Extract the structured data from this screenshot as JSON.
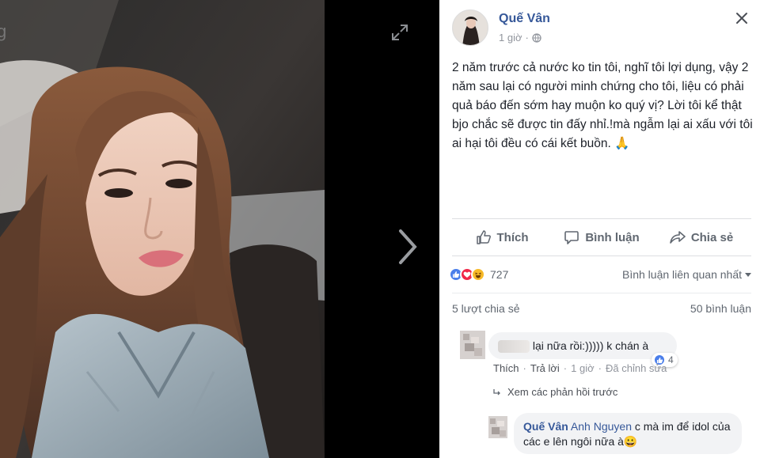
{
  "post": {
    "author": "Quế Vân",
    "time": "1 giờ",
    "text": "2 năm trước cả nước ko tin tôi, nghĩ tôi lợi dụng, vậy 2 năm sau lại có người minh chứng cho tôi, liệu có phải quả báo đến sớm hay muộn ko quý vị? Lời tôi kể thật bjo chắc sẽ được tin đấy nhỉ.!mà ngẫm lại ai xấu với tôi ai hại tôi đều có cái kết buồn. 🙏"
  },
  "actions": {
    "like": "Thích",
    "comment": "Bình luận",
    "share": "Chia sẻ"
  },
  "reactions": {
    "count": "727",
    "types": [
      "like-icon",
      "love-icon",
      "haha-icon"
    ],
    "colors": {
      "like": "#4a7eea",
      "love": "#f0284a",
      "haha": "#f7b928"
    }
  },
  "sort": {
    "label": "Bình luận liên quan nhất"
  },
  "stats": {
    "shares": "5 lượt chia sẻ",
    "comments": "50 bình luận"
  },
  "comments": [
    {
      "text": "lại nữa rồi:))))) k chán à",
      "likes": "4",
      "actions": {
        "like": "Thích",
        "reply": "Trả lời",
        "time": "1 giờ",
        "edited": "Đã chỉnh sửa"
      },
      "view_more": "Xem các phản hồi trước"
    },
    {
      "author": "Quế Vân",
      "tag": "Anh Nguyen",
      "text": "c mà im để idol của các e lên ngôi nữa à😀"
    }
  ],
  "colors": {
    "link": "#365899",
    "muted": "#90949c",
    "divider": "#dddfe2"
  }
}
